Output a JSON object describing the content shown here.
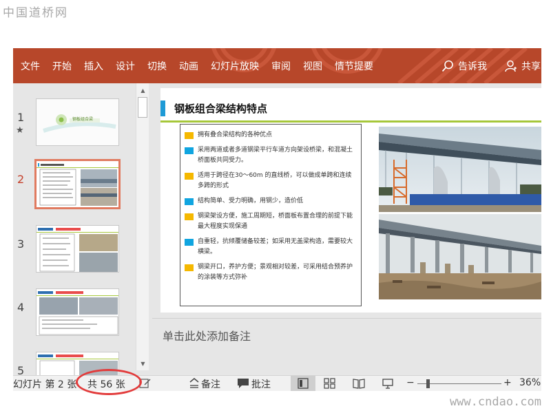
{
  "watermark": {
    "top_left": "中国道桥网",
    "bottom_right": "www.cndao.com"
  },
  "ribbon": {
    "tabs": [
      "文件",
      "开始",
      "插入",
      "设计",
      "切换",
      "动画",
      "幻灯片放映",
      "审阅",
      "视图",
      "情节提要"
    ],
    "tell_me": "告诉我",
    "share": "共享"
  },
  "thumbnails": [
    {
      "number": "1",
      "starred": true,
      "caption": "钢板组合梁"
    },
    {
      "number": "2",
      "active": true
    },
    {
      "number": "3"
    },
    {
      "number": "4"
    },
    {
      "number": "5"
    }
  ],
  "slide": {
    "title": "钢板组合梁结构特点",
    "bullets": [
      {
        "color": "#f5b800",
        "text": "拥有叠合梁结构的各种优点"
      },
      {
        "color": "#10a5e0",
        "text": "采用两道或者多道钢梁平行车道方向架设桥梁，和混凝土桥面板共同受力。"
      },
      {
        "color": "#f5b800",
        "text": "适用于跨径在30～60m 的直线桥，可以做成单跨和连续多跨的形式"
      },
      {
        "color": "#10a5e0",
        "text": "结构简单、受力明确，用钢少，造价低"
      },
      {
        "color": "#f5b800",
        "text": "钢梁架设方便，施工周期短，桥面板布置合理的前提下能最大程度实现保通"
      },
      {
        "color": "#10a5e0",
        "text": "自重轻，抗倾覆储备较差；如采用无盖梁构造，需要较大横梁。"
      },
      {
        "color": "#f5b800",
        "text": "钢梁开口，养护方便；景观相对较差，可采用结合预养护的涂装等方式弥补"
      }
    ]
  },
  "notes": {
    "placeholder": "单击此处添加备注"
  },
  "status_bar": {
    "slide_of": "幻灯片 第 2 张",
    "total": "共 56 张",
    "notes_label": "备注",
    "comments_label": "批注",
    "zoom_level": "36%",
    "zoom_minus": "−",
    "zoom_plus": "+"
  },
  "colors": {
    "ribbon": "#b7472a",
    "title_accent": "#1e9ad6",
    "rule": "#a6c73a",
    "highlight_ellipse": "#e23a3a"
  }
}
